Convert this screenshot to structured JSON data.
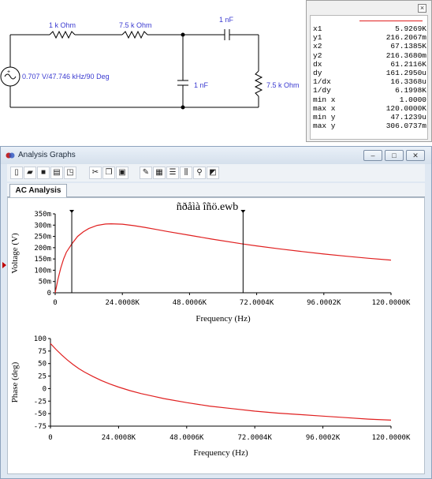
{
  "circuit": {
    "r1_label": "1 k Ohm",
    "r2_label": "7.5 k Ohm",
    "c1_label": "1 nF",
    "c2_label": "1 nF",
    "r3_label": "7.5 k Ohm",
    "source_label": "0.707 V/47.746 kHz/90 Deg"
  },
  "readout": {
    "close_icon": "close-icon",
    "trace_color": "#e02020",
    "rows": [
      {
        "key": "x1",
        "value": "5.9269K"
      },
      {
        "key": "y1",
        "value": "216.2067m"
      },
      {
        "key": "x2",
        "value": "67.1385K"
      },
      {
        "key": "y2",
        "value": "216.3680m"
      },
      {
        "key": "dx",
        "value": "61.2116K"
      },
      {
        "key": "dy",
        "value": "161.2950u"
      },
      {
        "key": "1/dx",
        "value": "16.3368u"
      },
      {
        "key": "1/dy",
        "value": "6.1998K"
      },
      {
        "key": "min x",
        "value": "1.0000"
      },
      {
        "key": "max x",
        "value": "120.0000K"
      },
      {
        "key": "min y",
        "value": "47.1239u"
      },
      {
        "key": "max y",
        "value": "306.0737m"
      }
    ]
  },
  "window": {
    "title": "Analysis Graphs",
    "minimize": "▭",
    "maximize": "□",
    "close": "✕",
    "toolbar": [
      "new-icon",
      "open-icon",
      "save-icon",
      "print-icon",
      "print-preview-icon",
      "cut-icon",
      "copy-icon",
      "paste-icon",
      "properties-icon",
      "grid-icon",
      "legend-icon",
      "cursor-icon",
      "zoom-icon",
      "copy-graph-icon"
    ],
    "tab": "AC Analysis"
  },
  "chart_data": [
    {
      "type": "line",
      "title": "ñðåìà îñö.ewb",
      "xlabel": "Frequency (Hz)",
      "ylabel": "Voltage (V)",
      "xlim": [
        0,
        120000
      ],
      "ylim": [
        0,
        0.35
      ],
      "x_ticks": [
        "0",
        "24.0008K",
        "48.0006K",
        "72.0004K",
        "96.0002K",
        "120.0000K"
      ],
      "y_ticks": [
        "0",
        "50m",
        "100m",
        "150m",
        "200m",
        "250m",
        "300m",
        "350m"
      ],
      "cursors": [
        5926.9,
        67138.5
      ],
      "series": [
        {
          "color": "#e02020",
          "x": [
            0,
            1000,
            2000,
            3000,
            4000,
            5926.9,
            8000,
            10000,
            12000,
            15000,
            18000,
            20000,
            24000,
            28000,
            32000,
            36000,
            40000,
            48000,
            56000,
            67138.5,
            72000,
            80000,
            88000,
            96000,
            104000,
            112000,
            120000
          ],
          "y": [
            0,
            0.06,
            0.11,
            0.15,
            0.18,
            0.2162,
            0.25,
            0.27,
            0.285,
            0.299,
            0.305,
            0.306,
            0.304,
            0.298,
            0.29,
            0.281,
            0.272,
            0.255,
            0.238,
            0.2164,
            0.208,
            0.195,
            0.183,
            0.172,
            0.162,
            0.153,
            0.145
          ]
        }
      ]
    },
    {
      "type": "line",
      "title": "",
      "xlabel": "Frequency (Hz)",
      "ylabel": "Phase (deg)",
      "xlim": [
        0,
        120000
      ],
      "ylim": [
        -75,
        100
      ],
      "x_ticks": [
        "0",
        "24.0008K",
        "48.0006K",
        "72.0004K",
        "96.0002K",
        "120.0000K"
      ],
      "y_ticks": [
        "100",
        "75",
        "50",
        "25",
        "0",
        "-25",
        "-50",
        "-75"
      ],
      "series": [
        {
          "color": "#e02020",
          "x": [
            0,
            2000,
            4000,
            6000,
            8000,
            10000,
            12000,
            15000,
            18000,
            21000,
            24000,
            28000,
            32000,
            36000,
            40000,
            48000,
            56000,
            64000,
            72000,
            80000,
            88000,
            96000,
            104000,
            112000,
            120000
          ],
          "y": [
            90,
            78,
            67,
            57,
            48,
            40,
            33,
            24,
            16,
            9,
            3,
            -4,
            -10,
            -15,
            -20,
            -28,
            -35,
            -40,
            -45,
            -49,
            -52,
            -55,
            -58,
            -61,
            -63
          ]
        }
      ]
    }
  ]
}
